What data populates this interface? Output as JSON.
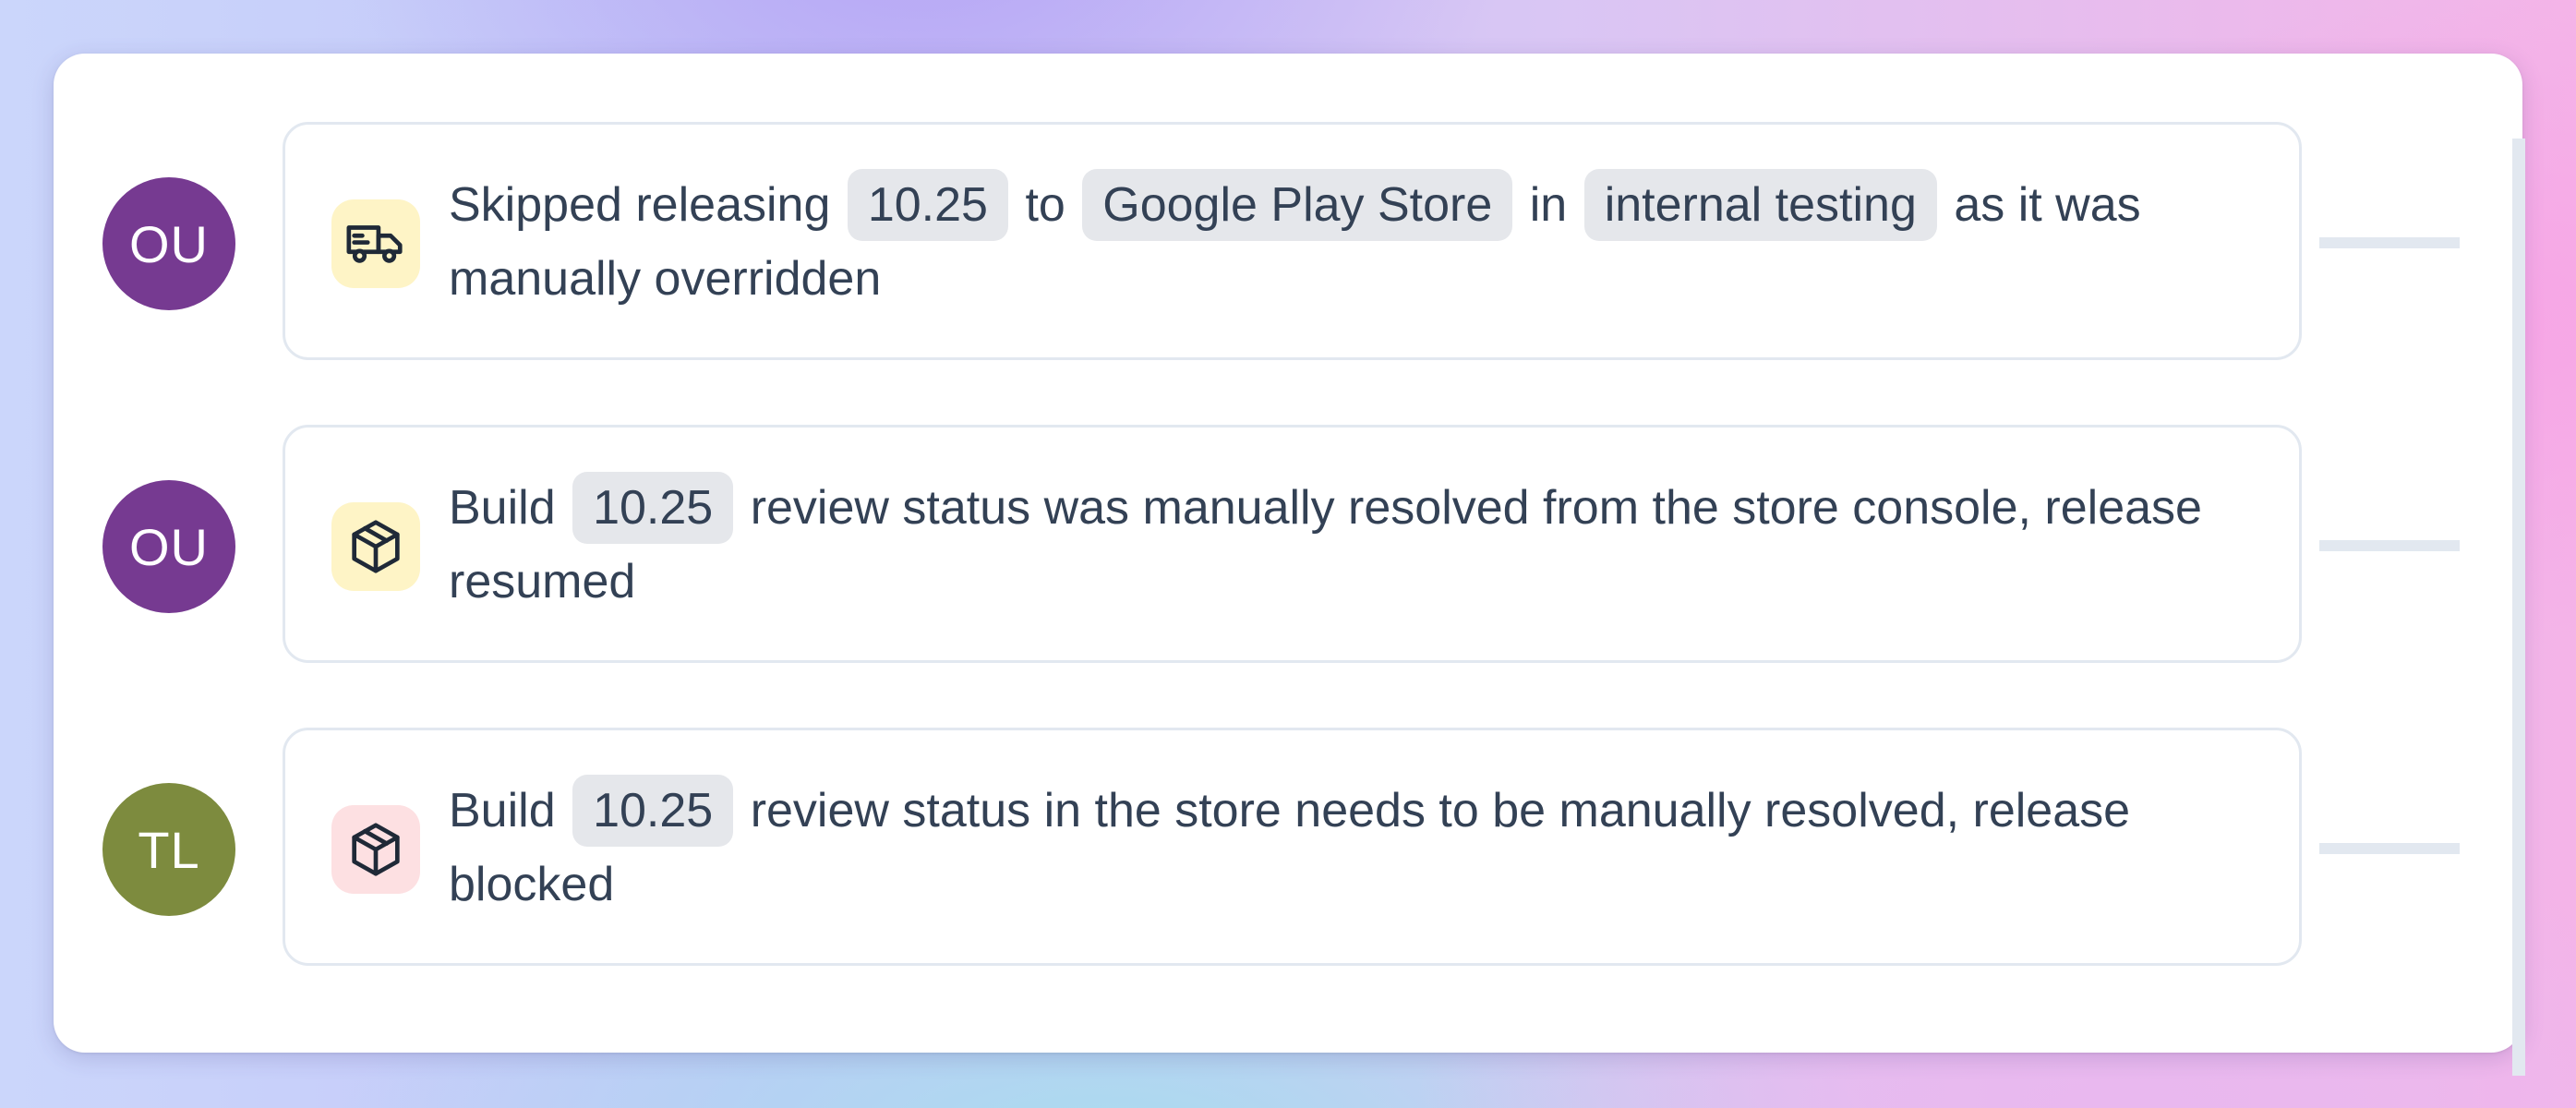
{
  "colors": {
    "avatar_ou": "#763a91",
    "avatar_tl": "#7d8b3e",
    "icon_bg_warning": "#fef4c6",
    "icon_bg_danger": "#fde0e2",
    "chip_bg": "#e5e7eb",
    "text": "#334155",
    "border": "#e2e8f0"
  },
  "events": [
    {
      "avatar": "OU",
      "icon": "delivery-truck-icon",
      "text_1": "Skipped releasing",
      "chip_version": "10.25",
      "text_2": "to",
      "chip_store": "Google Play Store",
      "text_3": "in",
      "chip_track": "internal testing",
      "text_4": "as it was manually overridden"
    },
    {
      "avatar": "OU",
      "icon": "package-box-icon",
      "text_1": "Build",
      "chip_version": "10.25",
      "text_2": "review status was manually resolved from the store console, release resumed"
    },
    {
      "avatar": "TL",
      "icon": "package-box-icon",
      "text_1": "Build",
      "chip_version": "10.25",
      "text_2": "review status in the store needs to be manually resolved, release blocked"
    }
  ]
}
